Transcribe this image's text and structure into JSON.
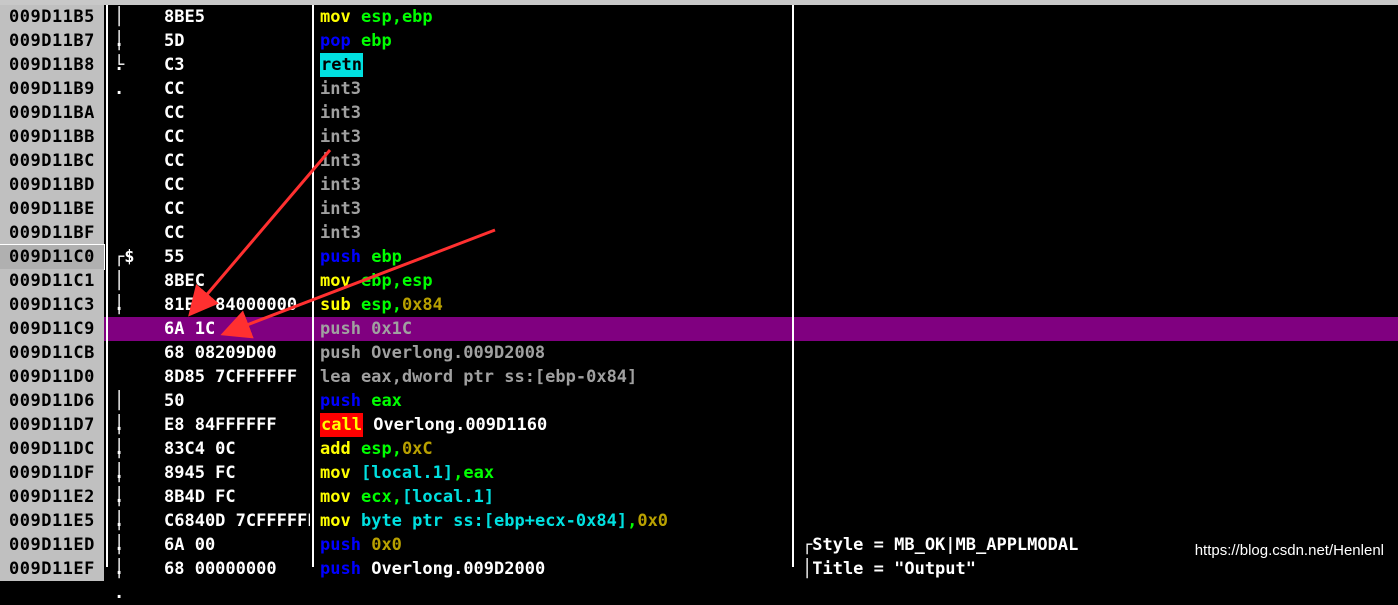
{
  "colors": {
    "mnemonic_yellow": "#ffff00",
    "mnemonic_blue": "#0000ff",
    "operand_green": "#00ff00",
    "operand_cyan": "#00e0e0",
    "number_olive": "#b8a000",
    "int3_gray": "#a0a0a0",
    "selection_purple": "#800080",
    "annotation_red": "#ff3030"
  },
  "rows": [
    {
      "addr": "009D11B5",
      "mark": "│ .",
      "hex": "8BE5",
      "dis": [
        {
          "t": "mov",
          "c": "y"
        },
        {
          "t": " "
        },
        {
          "t": "esp",
          "c": "g"
        },
        {
          "t": ",",
          "c": "g"
        },
        {
          "t": "ebp",
          "c": "g"
        }
      ]
    },
    {
      "addr": "009D11B7",
      "mark": "│ .",
      "hex": "5D",
      "dis": [
        {
          "t": "pop",
          "c": "b"
        },
        {
          "t": " "
        },
        {
          "t": "ebp",
          "c": "g"
        }
      ]
    },
    {
      "addr": "009D11B8",
      "mark": "└ .",
      "hex": "C3",
      "dis": [
        {
          "t": "retn",
          "c": "retn"
        }
      ]
    },
    {
      "addr": "009D11B9",
      "mark": "",
      "hex": "CC",
      "dis": [
        {
          "t": "int3",
          "c": "gray"
        }
      ]
    },
    {
      "addr": "009D11BA",
      "mark": "",
      "hex": "CC",
      "dis": [
        {
          "t": "int3",
          "c": "gray"
        }
      ]
    },
    {
      "addr": "009D11BB",
      "mark": "",
      "hex": "CC",
      "dis": [
        {
          "t": "int3",
          "c": "gray"
        }
      ]
    },
    {
      "addr": "009D11BC",
      "mark": "",
      "hex": "CC",
      "dis": [
        {
          "t": "int3",
          "c": "gray"
        }
      ]
    },
    {
      "addr": "009D11BD",
      "mark": "",
      "hex": "CC",
      "dis": [
        {
          "t": "int3",
          "c": "gray"
        }
      ]
    },
    {
      "addr": "009D11BE",
      "mark": "",
      "hex": "CC",
      "dis": [
        {
          "t": "int3",
          "c": "gray"
        }
      ]
    },
    {
      "addr": "009D11BF",
      "mark": "",
      "hex": "CC",
      "dis": [
        {
          "t": "int3",
          "c": "gray"
        }
      ]
    },
    {
      "addr": "009D11C0",
      "mark": "┌$",
      "hex": "55",
      "cur": true,
      "dis": [
        {
          "t": "push",
          "c": "b"
        },
        {
          "t": " "
        },
        {
          "t": "ebp",
          "c": "g"
        }
      ]
    },
    {
      "addr": "009D11C1",
      "mark": "│ .",
      "hex": "8BEC",
      "dis": [
        {
          "t": "mov",
          "c": "y"
        },
        {
          "t": " "
        },
        {
          "t": "ebp",
          "c": "g"
        },
        {
          "t": ",",
          "c": "g"
        },
        {
          "t": "esp",
          "c": "g"
        }
      ]
    },
    {
      "addr": "009D11C3",
      "mark": "│ .",
      "hex": "81EC 84000000",
      "dis": [
        {
          "t": "sub",
          "c": "y"
        },
        {
          "t": " "
        },
        {
          "t": "esp",
          "c": "g"
        },
        {
          "t": ",",
          "c": "g"
        },
        {
          "t": "0x84",
          "c": "o"
        }
      ]
    },
    {
      "addr": "009D11C9",
      "mark": "",
      "hex": "6A 1C",
      "sel": true,
      "dis": [
        {
          "t": "push 0x1C",
          "c": "gray"
        }
      ]
    },
    {
      "addr": "009D11CB",
      "mark": "",
      "hex": "68 08209D00",
      "dis": [
        {
          "t": "push Overlong.009D2008",
          "c": "gray"
        }
      ]
    },
    {
      "addr": "009D11D0",
      "mark": "",
      "hex": "8D85 7CFFFFFF",
      "dis": [
        {
          "t": "lea eax,dword ptr ss:[ebp-0x84]",
          "c": "gray"
        }
      ]
    },
    {
      "addr": "009D11D6",
      "mark": "│ .",
      "hex": "50",
      "dis": [
        {
          "t": "push",
          "c": "b"
        },
        {
          "t": " "
        },
        {
          "t": "eax",
          "c": "g"
        }
      ]
    },
    {
      "addr": "009D11D7",
      "mark": "│ .",
      "hex": "E8 84FFFFFF",
      "dis": [
        {
          "t": "call",
          "c": "call"
        },
        {
          "t": " "
        },
        {
          "t": "Overlong.009D1160",
          "c": "w"
        }
      ]
    },
    {
      "addr": "009D11DC",
      "mark": "│ .",
      "hex": "83C4 0C",
      "dis": [
        {
          "t": "add",
          "c": "y"
        },
        {
          "t": " "
        },
        {
          "t": "esp",
          "c": "g"
        },
        {
          "t": ",",
          "c": "g"
        },
        {
          "t": "0xC",
          "c": "o"
        }
      ]
    },
    {
      "addr": "009D11DF",
      "mark": "│ .",
      "hex": "8945 FC",
      "dis": [
        {
          "t": "mov",
          "c": "y"
        },
        {
          "t": " "
        },
        {
          "t": "[local.1]",
          "c": "c"
        },
        {
          "t": ",",
          "c": "g"
        },
        {
          "t": "eax",
          "c": "g"
        }
      ]
    },
    {
      "addr": "009D11E2",
      "mark": "│ .",
      "hex": "8B4D FC",
      "dis": [
        {
          "t": "mov",
          "c": "y"
        },
        {
          "t": " "
        },
        {
          "t": "ecx",
          "c": "g"
        },
        {
          "t": ",",
          "c": "g"
        },
        {
          "t": "[local.1]",
          "c": "c"
        }
      ]
    },
    {
      "addr": "009D11E5",
      "mark": "│ .",
      "hex": "C6840D 7CFFFFFF",
      "dis": [
        {
          "t": "mov",
          "c": "y"
        },
        {
          "t": " "
        },
        {
          "t": "byte ptr ss:[ebp+ecx-0x84]",
          "c": "c"
        },
        {
          "t": ",",
          "c": "g"
        },
        {
          "t": "0x0",
          "c": "o"
        }
      ]
    },
    {
      "addr": "009D11ED",
      "mark": "│ .",
      "hex": "6A 00",
      "cmt": "┌Style = MB_OK|MB_APPLMODAL",
      "dis": [
        {
          "t": "push",
          "c": "b"
        },
        {
          "t": " "
        },
        {
          "t": "0x0",
          "c": "o"
        }
      ]
    },
    {
      "addr": "009D11EF",
      "mark": "│ .",
      "hex": "68 00000000",
      "cmt": "│Title = \"Output\"",
      "dis": [
        {
          "t": "push",
          "c": "b"
        },
        {
          "t": " "
        },
        {
          "t": "Overlong.009D2000",
          "c": "w"
        }
      ]
    }
  ],
  "watermark": "https://blog.csdn.net/Henlenl"
}
